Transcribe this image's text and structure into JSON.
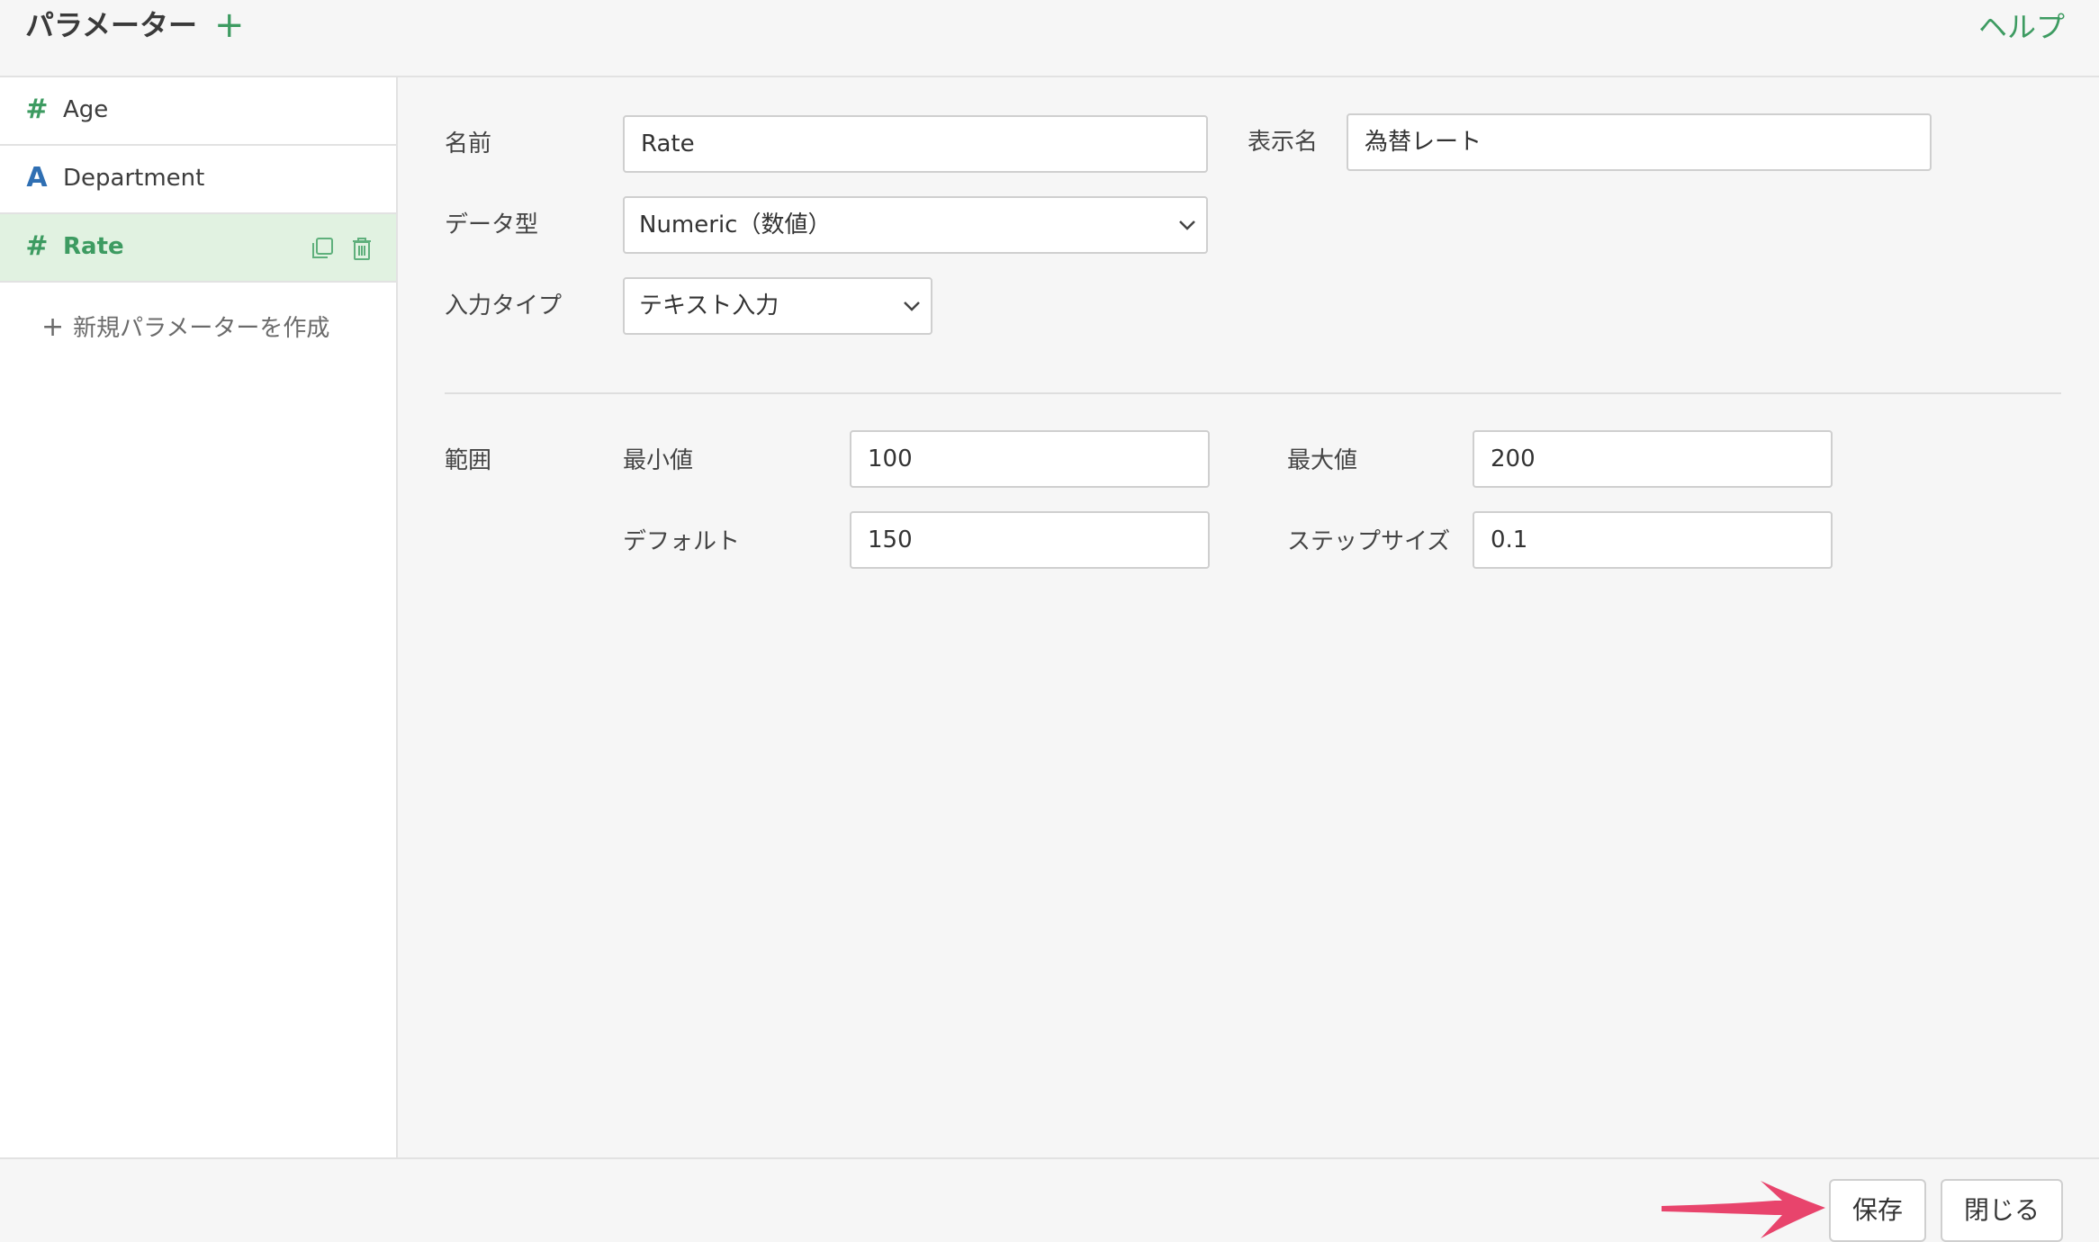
{
  "header": {
    "title": "パラメーター",
    "add_symbol": "+",
    "help_label": "ヘルプ"
  },
  "sidebar": {
    "items": [
      {
        "type_glyph": "#",
        "label": "Age"
      },
      {
        "type_glyph": "A",
        "label": "Department"
      },
      {
        "type_glyph": "#",
        "label": "Rate",
        "active": true
      }
    ],
    "new_param_plus": "+",
    "new_param_label": "新規パラメーターを作成"
  },
  "form": {
    "name_label": "名前",
    "name_value": "Rate",
    "display_name_label": "表示名",
    "display_name_value": "為替レート",
    "data_type_label": "データ型",
    "data_type_value": "Numeric（数値）",
    "input_type_label": "入力タイプ",
    "input_type_value": "テキスト入力",
    "range_label": "範囲",
    "min_label": "最小値",
    "min_value": "100",
    "max_label": "最大値",
    "max_value": "200",
    "default_label": "デフォルト",
    "default_value": "150",
    "step_label": "ステップサイズ",
    "step_value": "0.1"
  },
  "footer": {
    "save_label": "保存",
    "close_label": "閉じる"
  },
  "colors": {
    "accent_green": "#3d9b61",
    "active_bg": "#e1f2e1",
    "type_text_blue": "#2f6fb3",
    "arrow_pink": "#e8446c"
  }
}
